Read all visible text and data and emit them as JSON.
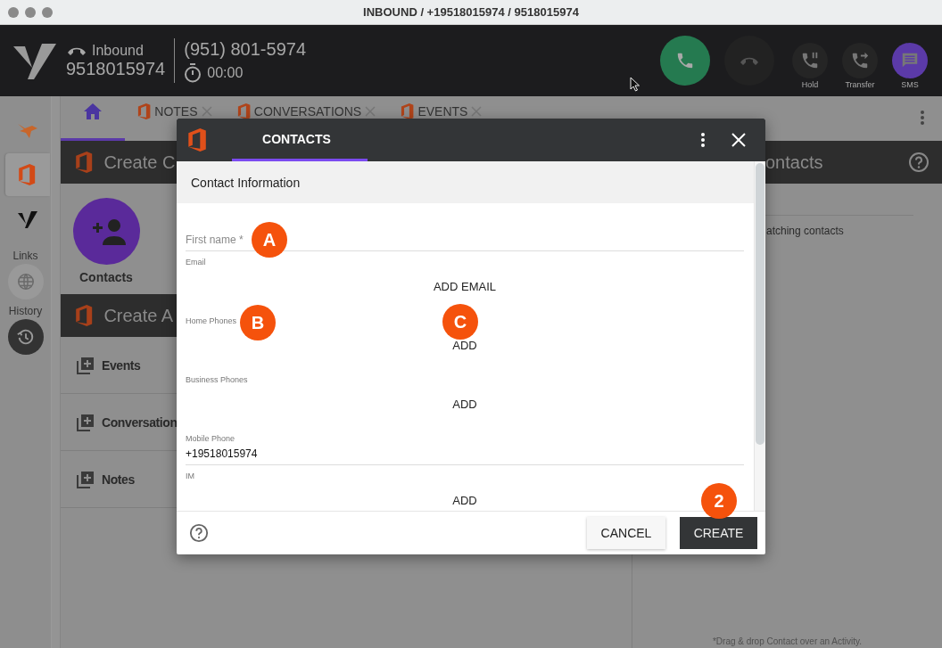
{
  "window": {
    "title": "INBOUND / +19518015974 / 9518015974"
  },
  "call_bar": {
    "direction": "Inbound",
    "number": "9518015974",
    "caller": "(951) 801-5974",
    "timer": "00:00",
    "actions": [
      {
        "kind": "answer"
      },
      {
        "kind": "hangup"
      },
      {
        "kind": "hold",
        "label": "Hold"
      },
      {
        "kind": "transfer",
        "label": "Transfer"
      },
      {
        "kind": "sms",
        "label": "SMS"
      }
    ]
  },
  "rail": {
    "items": [
      {
        "kind": "fox",
        "selected": false
      },
      {
        "kind": "office",
        "selected": true
      },
      {
        "kind": "logo",
        "selected": false
      }
    ],
    "links_label": "Links",
    "history_label": "History"
  },
  "tabs": [
    {
      "kind": "home",
      "selected": true
    },
    {
      "kind": "office",
      "label": "NOTES",
      "selected": false
    },
    {
      "kind": "office",
      "label": "CONVERSATIONS",
      "selected": false
    },
    {
      "kind": "office",
      "label": "EVENTS",
      "selected": false
    }
  ],
  "left_panel": {
    "create_contact_title": "Create C",
    "contact_button": "Contacts",
    "create_activity_title": "Create A",
    "activities": [
      "Events",
      "Conversation",
      "Notes"
    ]
  },
  "right_panel": {
    "title": "ontacts",
    "status": "atching contacts",
    "footer": "*Drag & drop Contact over an Activity."
  },
  "dialog": {
    "tab": "CONTACTS",
    "section": "Contact Information",
    "fields": [
      {
        "kind": "text",
        "placeholder": "First name *"
      },
      {
        "kind": "add",
        "label": "Email",
        "action": "ADD EMAIL"
      },
      {
        "kind": "add",
        "label": "Home Phones",
        "action": "ADD"
      },
      {
        "kind": "add",
        "label": "Business Phones",
        "action": "ADD"
      },
      {
        "kind": "text",
        "label": "Mobile Phone",
        "value": "+19518015974"
      },
      {
        "kind": "add",
        "label": "IM",
        "action": "ADD"
      }
    ],
    "cancel": "CANCEL",
    "create": "CREATE"
  },
  "callouts": [
    "A",
    "B",
    "C",
    "2"
  ]
}
